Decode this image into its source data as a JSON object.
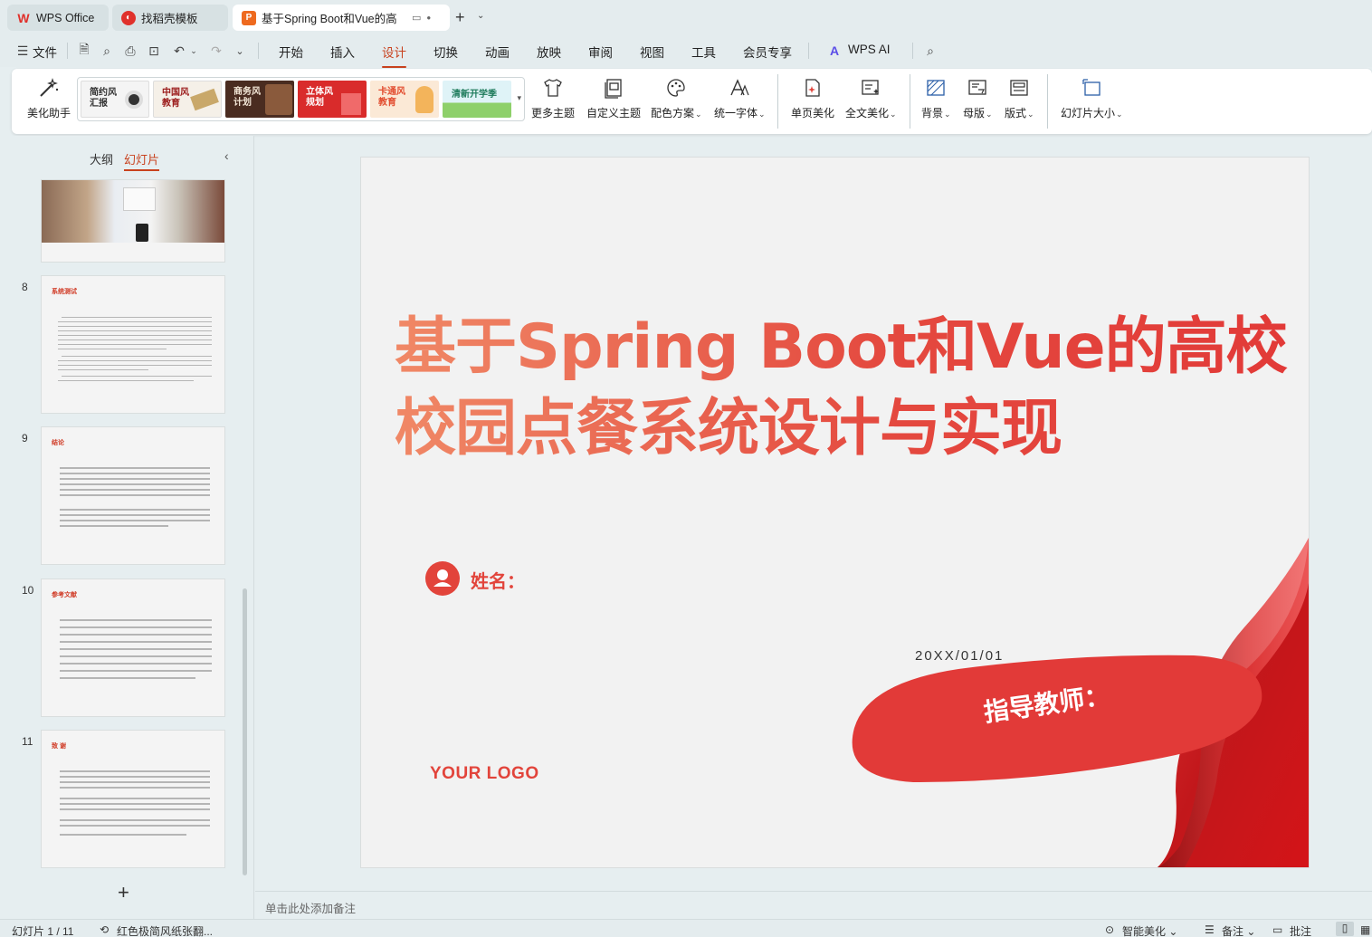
{
  "tabs": [
    {
      "label": "WPS Office",
      "icon": "wps-logo-icon"
    },
    {
      "label": "找稻壳模板",
      "icon": "docer-icon"
    },
    {
      "label": "基于Spring Boot和Vue的高",
      "icon": "presentation-icon"
    }
  ],
  "menu": {
    "file": "文件",
    "items": [
      "开始",
      "插入",
      "设计",
      "切换",
      "动画",
      "放映",
      "审阅",
      "视图",
      "工具",
      "会员专享"
    ],
    "active": "设计",
    "wps_ai": "WPS AI"
  },
  "ribbon": {
    "beautify": "美化助手",
    "templates": [
      {
        "label": "简约风汇报",
        "l1": "简约风",
        "l2": "汇报"
      },
      {
        "label": "中国风教育",
        "l1": "中国风",
        "l2": "教育"
      },
      {
        "label": "商务风计划",
        "l1": "商务风",
        "l2": "计划"
      },
      {
        "label": "立体风规划",
        "l1": "立体风",
        "l2": "规划"
      },
      {
        "label": "卡通风教育",
        "l1": "卡通风",
        "l2": "教育"
      },
      {
        "label": "清新开学季",
        "l1": "清新开学季",
        "l2": ""
      }
    ],
    "more_themes": "更多主题",
    "custom_theme": "自定义主题",
    "color_scheme": "配色方案",
    "unify_font": "统一字体",
    "page_beautify": "单页美化",
    "full_beautify": "全文美化",
    "background": "背景",
    "master": "母版",
    "layout": "版式",
    "slide_size": "幻灯片大小"
  },
  "panel": {
    "outline_tab": "大纲",
    "slides_tab": "幻灯片",
    "slides": [
      {
        "num": "",
        "title": ""
      },
      {
        "num": "8",
        "title": "系统测试"
      },
      {
        "num": "9",
        "title": "结论"
      },
      {
        "num": "10",
        "title": "参考文献"
      },
      {
        "num": "11",
        "title": "致 谢"
      }
    ]
  },
  "slide": {
    "title": "基于Spring Boot和Vue的高校校园点餐系统设计与实现",
    "name_label": "姓名：",
    "date": "20XX/01/01",
    "teacher_label": "指导教师：",
    "logo": "YOUR LOGO"
  },
  "notes": {
    "placeholder": "单击此处添加备注"
  },
  "status": {
    "slide_counter": "幻灯片 1 / 11",
    "theme_name": "红色极简风纸张翻...",
    "smart_beautify": "智能美化",
    "notes_btn": "备注",
    "comment_btn": "批注"
  },
  "colors": {
    "accent": "#c8421e",
    "slide_red": "#e2443b"
  }
}
